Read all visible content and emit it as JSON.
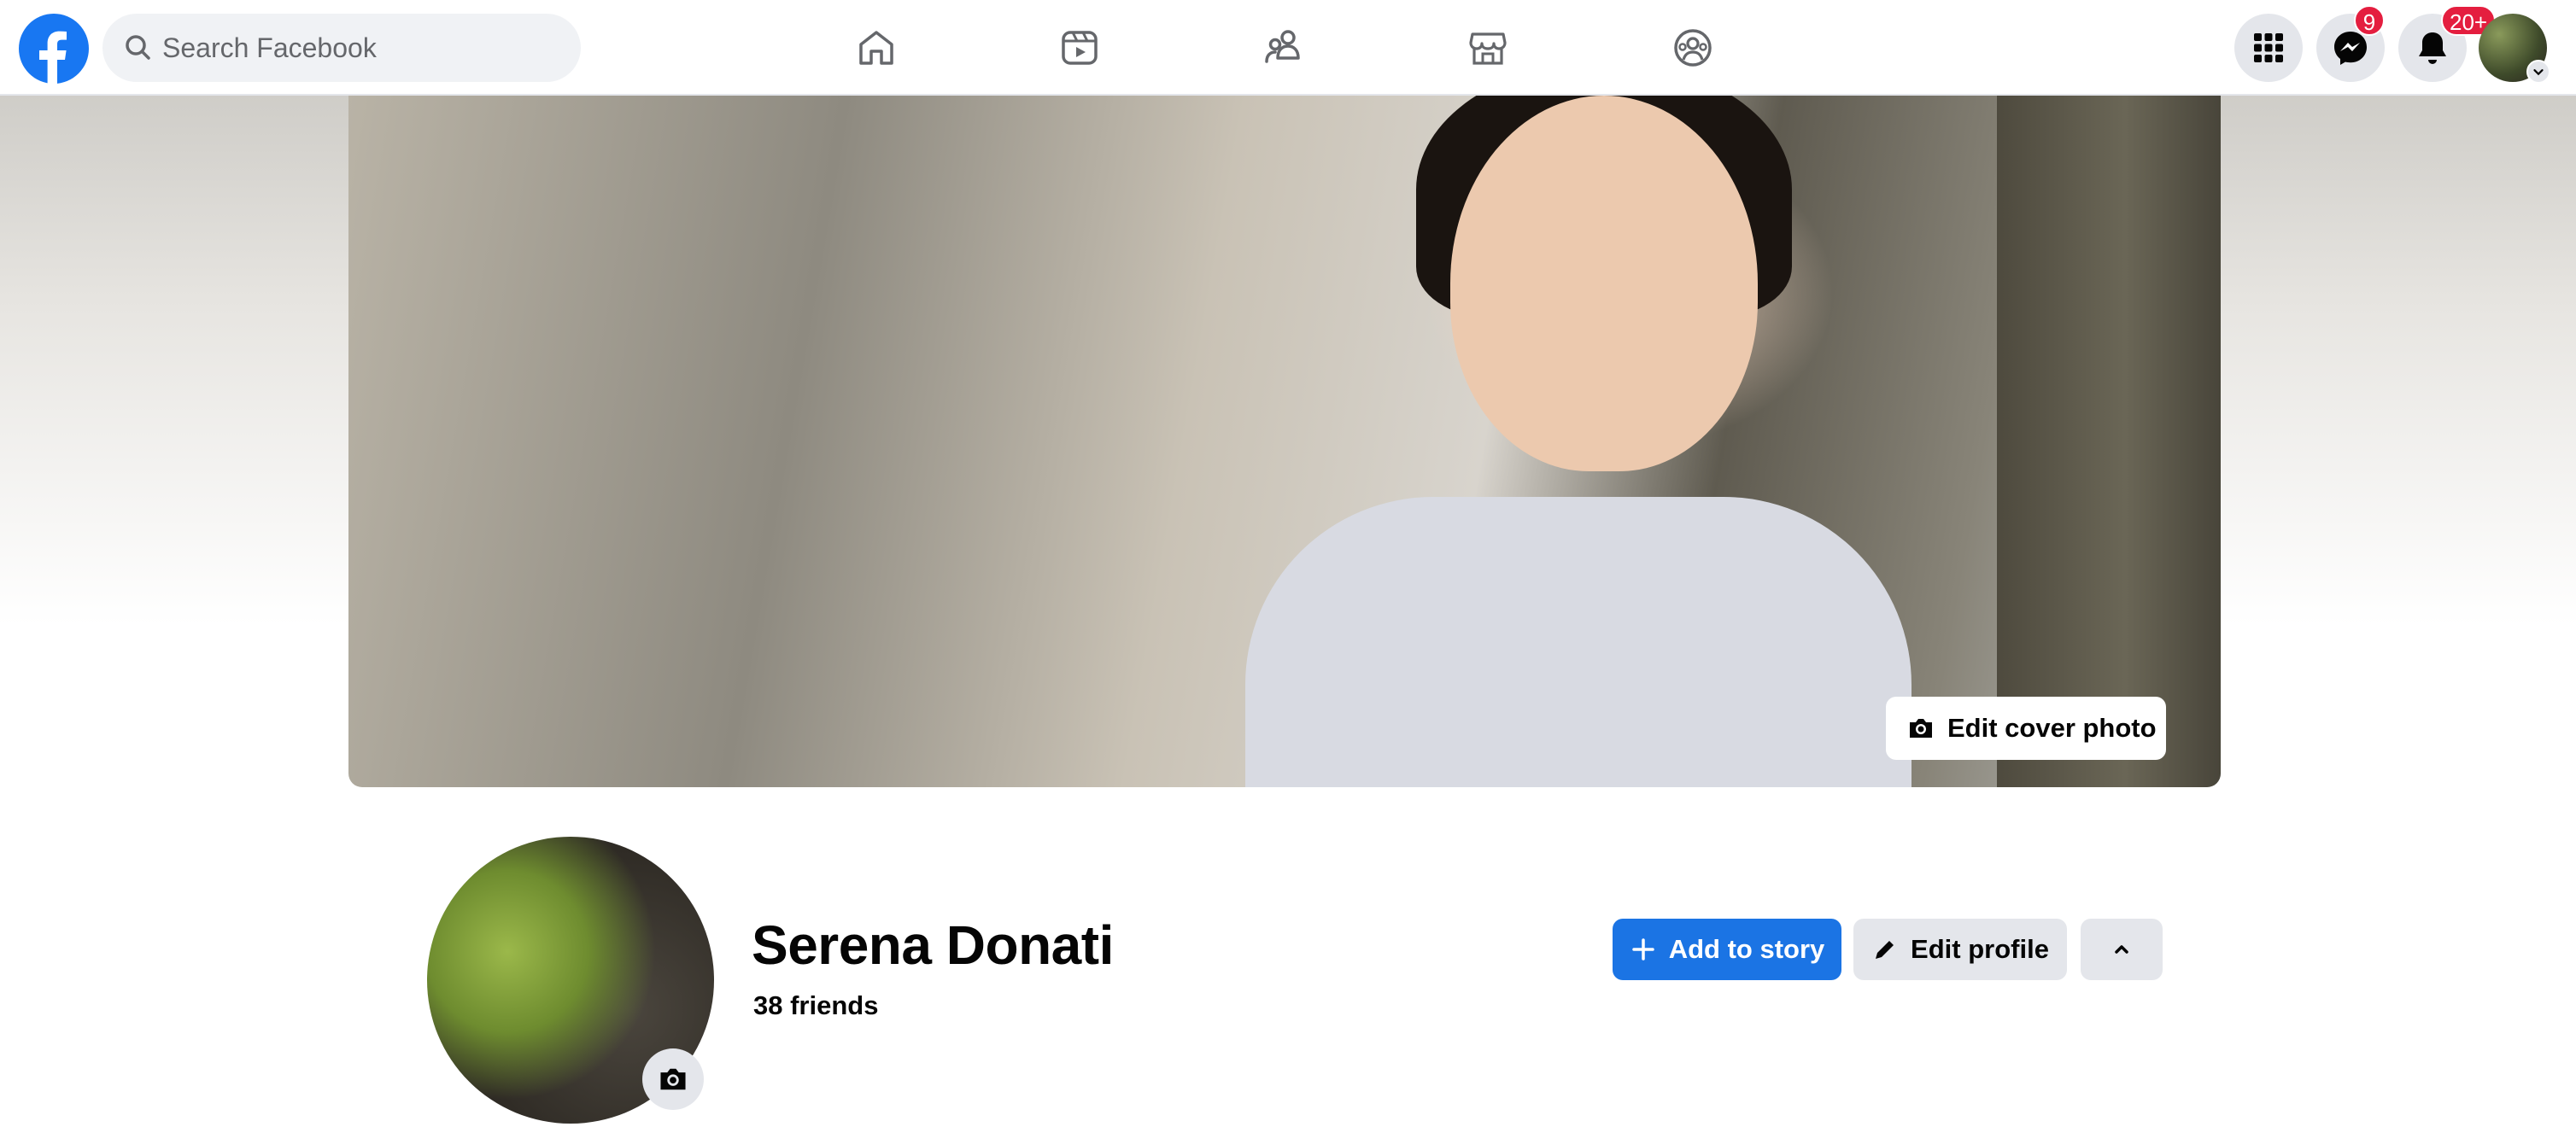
{
  "topbar": {
    "logo_icon": "facebook-logo-icon",
    "search": {
      "placeholder": "Search Facebook",
      "value": ""
    },
    "nav": [
      {
        "name": "home",
        "icon": "home-icon"
      },
      {
        "name": "video",
        "icon": "video-icon"
      },
      {
        "name": "friends",
        "icon": "friends-icon"
      },
      {
        "name": "marketplace",
        "icon": "marketplace-icon"
      },
      {
        "name": "groups",
        "icon": "groups-icon"
      }
    ],
    "menu_icon": "grid-menu-icon",
    "messenger": {
      "icon": "messenger-icon",
      "badge": "9"
    },
    "notifications": {
      "icon": "bell-icon",
      "badge": "20+"
    },
    "account_icon": "account-avatar"
  },
  "cover": {
    "edit_label": "Edit cover photo"
  },
  "profile": {
    "name": "Serena Donati",
    "friends": "38 friends",
    "actions": {
      "add_story": "Add to story",
      "edit_profile": "Edit profile"
    }
  },
  "colors": {
    "brand": "#1877f2",
    "primary_button": "#1b74e4",
    "secondary_button": "#e4e6eb",
    "badge": "#e41e3f"
  }
}
